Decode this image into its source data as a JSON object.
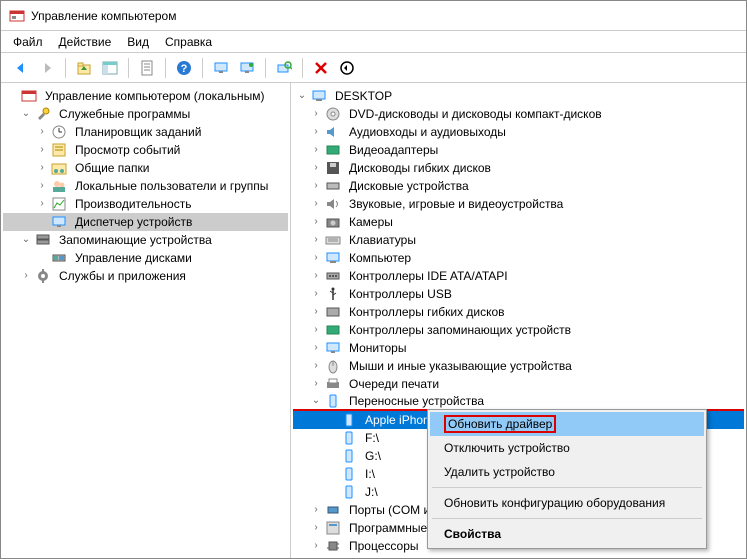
{
  "window": {
    "title": "Управление компьютером"
  },
  "menu": {
    "file": "Файл",
    "action": "Действие",
    "view": "Вид",
    "help": "Справка"
  },
  "left_tree": {
    "root": "Управление компьютером (локальным)",
    "system_tools": "Служебные программы",
    "task_scheduler": "Планировщик заданий",
    "event_viewer": "Просмотр событий",
    "shared_folders": "Общие папки",
    "local_users": "Локальные пользователи и группы",
    "performance": "Производительность",
    "device_manager": "Диспетчер устройств",
    "storage": "Запоминающие устройства",
    "disk_mgmt": "Управление дисками",
    "services_apps": "Службы и приложения"
  },
  "right_tree": {
    "root": "DESKTOP",
    "dvd_cd": "DVD-дисководы и дисководы компакт-дисков",
    "audio": "Аудиовходы и аудиовыходы",
    "video": "Видеоадаптеры",
    "floppy": "Дисководы гибких дисков",
    "disk_drives": "Дисковые устройства",
    "sound_game": "Звуковые, игровые и видеоустройства",
    "cameras": "Камеры",
    "keyboards": "Клавиатуры",
    "computer": "Компьютер",
    "ide_atapi": "Контроллеры IDE ATA/ATAPI",
    "usb": "Контроллеры USB",
    "floppy_ctrl": "Контроллеры гибких дисков",
    "storage_ctrl": "Контроллеры запоминающих устройств",
    "monitors": "Мониторы",
    "mice": "Мыши и иные указывающие устройства",
    "print_queues": "Очереди печати",
    "portable": "Переносные устройства",
    "portable_items": [
      "Apple iPhone",
      "F:\\",
      "G:\\",
      "I:\\",
      "J:\\"
    ],
    "ports": "Порты (COM и L",
    "software": "Программные у",
    "processors": "Процессоры"
  },
  "context_menu": {
    "update_driver": "Обновить драйвер",
    "disable_device": "Отключить устройство",
    "remove_device": "Удалить устройство",
    "scan_hw": "Обновить конфигурацию оборудования",
    "properties": "Свойства"
  }
}
